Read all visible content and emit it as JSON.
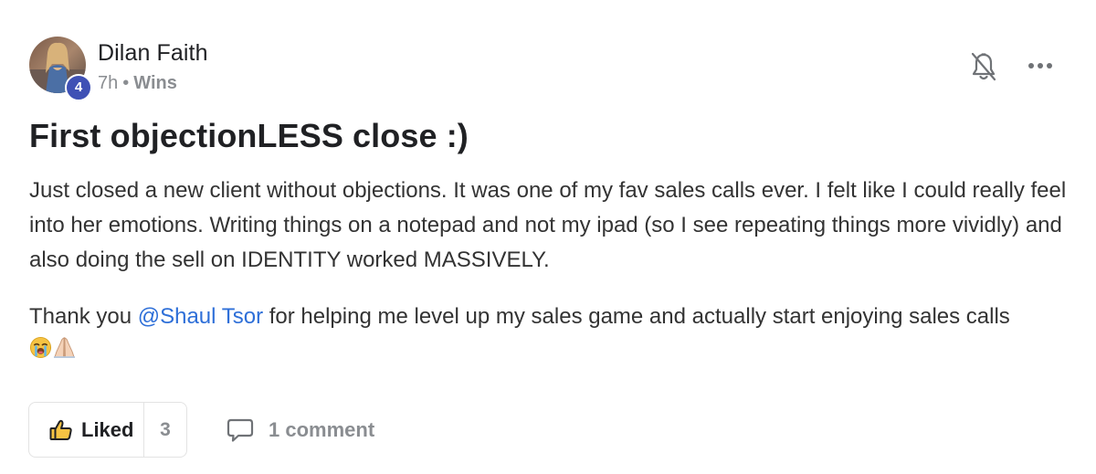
{
  "author": {
    "name": "Dilan Faith",
    "level": "4"
  },
  "meta": {
    "time": "7h",
    "separator": "•",
    "category": "Wins"
  },
  "post": {
    "title": "First objectionLESS close :)",
    "paragraph1": "Just closed a new client without objections. It was one of my fav sales calls ever. I felt like I could really feel into her emotions. Writing things on a notepad and not my ipad (so I see repeating things more vividly) and also doing the sell on IDENTITY worked MASSIVELY.",
    "paragraph2_before": "Thank you ",
    "mention": "@Shaul Tsor",
    "paragraph2_after": " for helping me level up my sales game and actually start enjoying sales calls",
    "emojis": [
      "loudly-crying-face",
      "folded-hands"
    ]
  },
  "actions": {
    "like_label": "Liked",
    "like_count": "3",
    "comment_label": "1 comment",
    "bell_icon": "bell-off-icon",
    "more_icon": "more-dots-icon"
  },
  "colors": {
    "mention": "#2e6fd8",
    "badge": "#3f51b5",
    "muted": "#8a8d91"
  }
}
